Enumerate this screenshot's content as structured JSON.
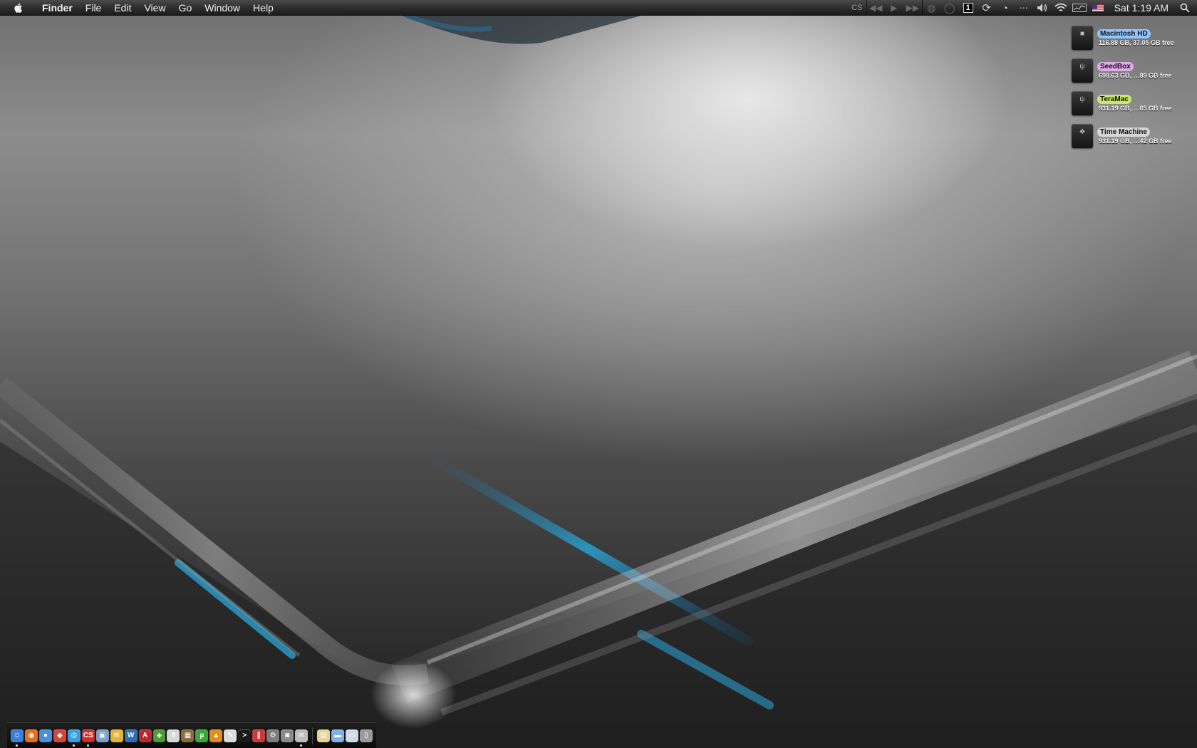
{
  "menubar": {
    "apple_icon": "apple-logo-icon",
    "items": [
      "Finder",
      "File",
      "Edit",
      "View",
      "Go",
      "Window",
      "Help"
    ],
    "extras": {
      "cs": "CS",
      "space_number": "1",
      "clock": "Sat 1:19 AM"
    }
  },
  "drives": [
    {
      "name": "Macintosh HD",
      "info": "116.88 GB, 37.05 GB free",
      "label_color": "#8fc5ff",
      "glyph": "■"
    },
    {
      "name": "SeedBox",
      "info": "698.63 GB, …89 GB free",
      "label_color": "#e3a8e8",
      "glyph": "ψ"
    },
    {
      "name": "TeraMac",
      "info": "931.19 GB, …65 GB free",
      "label_color": "#c9e86a",
      "glyph": "ψ"
    },
    {
      "name": "Time Machine",
      "info": "931.19 GB, …42 GB free",
      "label_color": "#d6d6d6",
      "glyph": "❖"
    }
  ],
  "dock": {
    "apps": [
      {
        "name": "finder",
        "color": "#3b7fd6",
        "glyph": "☺",
        "running": true
      },
      {
        "name": "firefox",
        "color": "#e86c1f",
        "glyph": "◉",
        "running": false
      },
      {
        "name": "ichat",
        "color": "#4a90d9",
        "glyph": "●",
        "running": false
      },
      {
        "name": "pages",
        "color": "#d9443a",
        "glyph": "◆",
        "running": false
      },
      {
        "name": "safari",
        "color": "#3aa0e0",
        "glyph": "◎",
        "running": true
      },
      {
        "name": "cs-app",
        "color": "#c9302c",
        "glyph": "CS",
        "running": true
      },
      {
        "name": "preview",
        "color": "#7a9fc9",
        "glyph": "▣",
        "running": false
      },
      {
        "name": "mail",
        "color": "#e2b533",
        "glyph": "✉",
        "running": false
      },
      {
        "name": "word",
        "color": "#2f6fb5",
        "glyph": "W",
        "running": false
      },
      {
        "name": "acrobat",
        "color": "#b52a2a",
        "glyph": "A",
        "running": false
      },
      {
        "name": "transmission",
        "color": "#4a9c3a",
        "glyph": "◈",
        "running": false
      },
      {
        "name": "ical",
        "color": "#d7d7d7",
        "glyph": "9",
        "running": false
      },
      {
        "name": "photo",
        "color": "#8a6a3a",
        "glyph": "▦",
        "running": false
      },
      {
        "name": "utorrent",
        "color": "#3aa83a",
        "glyph": "µ",
        "running": false
      },
      {
        "name": "vlc",
        "color": "#e58a1b",
        "glyph": "▲",
        "running": false
      },
      {
        "name": "textedit",
        "color": "#dcdcdc",
        "glyph": "✎",
        "running": false
      },
      {
        "name": "terminal",
        "color": "#1a1a1a",
        "glyph": ">",
        "running": false
      },
      {
        "name": "parallels",
        "color": "#c93a3a",
        "glyph": "∥",
        "running": false
      },
      {
        "name": "system-preferences",
        "color": "#7d7d7d",
        "glyph": "⚙",
        "running": false
      },
      {
        "name": "screenshot",
        "color": "#8a8a8a",
        "glyph": "◙",
        "running": false
      },
      {
        "name": "mail-2",
        "color": "#bdbdbd",
        "glyph": "✉",
        "running": true
      }
    ],
    "stacks": [
      {
        "name": "documents-stack",
        "color": "#e8d29a",
        "glyph": "▤"
      },
      {
        "name": "folder-stack",
        "color": "#7fb1e8",
        "glyph": "▬"
      },
      {
        "name": "downloads-stack",
        "color": "#cfd8e6",
        "glyph": "▭"
      },
      {
        "name": "trash",
        "color": "#9a9a9a",
        "glyph": "▯"
      }
    ]
  }
}
